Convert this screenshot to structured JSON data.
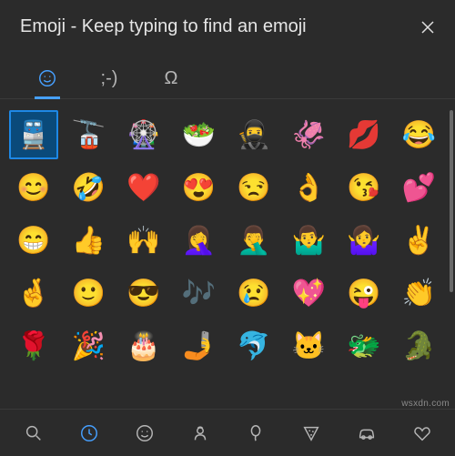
{
  "header": {
    "title": "Emoji - Keep typing to find an emoji"
  },
  "tabs": {
    "emoji": "☺",
    "kaomoji": ";-)",
    "symbols": "Ω"
  },
  "emoji_grid": {
    "selected_index": 0,
    "rows": [
      [
        "🚆",
        "🚡",
        "🎡",
        "🥗",
        "🥷",
        "🦑",
        "💋",
        "😂"
      ],
      [
        "😊",
        "🤣",
        "❤️",
        "😍",
        "😒",
        "👌",
        "😘",
        "💕"
      ],
      [
        "😁",
        "👍",
        "🙌",
        "🤦‍♀️",
        "🤦‍♂️",
        "🤷‍♂️",
        "🤷‍♀️",
        "✌️"
      ],
      [
        "🤞",
        "🙂",
        "😎",
        "🎶",
        "😢",
        "💖",
        "😜",
        "👏"
      ],
      [
        "🌹",
        "🎉",
        "🎂",
        "🤳",
        "🐬",
        "🐱",
        "🐲",
        "🐊"
      ]
    ]
  },
  "categories": {
    "search": "search-icon",
    "recent": "clock-icon",
    "smileys": "smiley-icon",
    "people": "people-icon",
    "celebration": "balloon-icon",
    "food": "pizza-icon",
    "transport": "car-icon",
    "hearts": "heart-icon"
  },
  "watermark": "wsxdn.com"
}
